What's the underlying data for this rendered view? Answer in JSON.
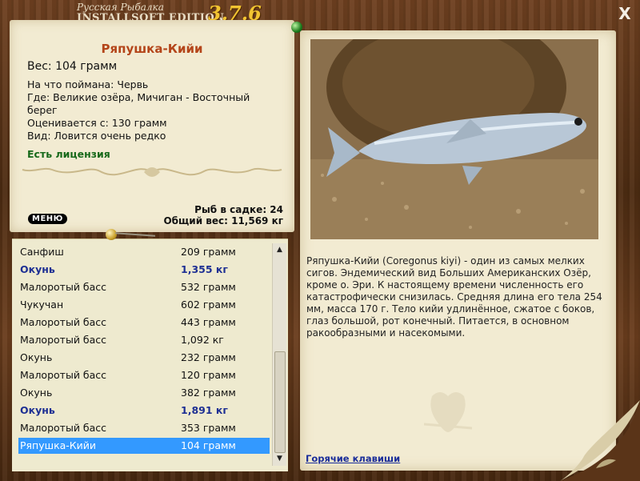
{
  "app": {
    "brand_line1": "Русская Рыбалка",
    "brand_line2": "INSTALLSOFT EDITION",
    "version": "3.7.6",
    "close_label": "X"
  },
  "fish_card": {
    "title": "Ряпушка-Кийи",
    "weight_text": "Вес: 104 грамм",
    "bait_text": "На что поймана: Червь",
    "location_text": "Где: Великие озёра, Мичиган - Восточный берег",
    "valued_from_text": "Оценивается с: 130 грамм",
    "rarity_text": "Вид: Ловится очень редко",
    "license_text": "Есть лицензия"
  },
  "keepnet": {
    "count_text": "Рыб в садке: 24",
    "total_weight_text": "Общий вес: 11,569 кг",
    "menu_label": "МЕНЮ"
  },
  "catch_list": [
    {
      "name": "Санфиш",
      "weight": "209 грамм",
      "bold": false,
      "selected": false
    },
    {
      "name": "Окунь",
      "weight": "1,355 кг",
      "bold": true,
      "selected": false
    },
    {
      "name": "Малоротый басс",
      "weight": "532 грамм",
      "bold": false,
      "selected": false
    },
    {
      "name": "Чукучан",
      "weight": "602 грамм",
      "bold": false,
      "selected": false
    },
    {
      "name": "Малоротый басс",
      "weight": "443 грамм",
      "bold": false,
      "selected": false
    },
    {
      "name": "Малоротый басс",
      "weight": "1,092 кг",
      "bold": false,
      "selected": false
    },
    {
      "name": "Окунь",
      "weight": "232 грамм",
      "bold": false,
      "selected": false
    },
    {
      "name": "Малоротый басс",
      "weight": "120 грамм",
      "bold": false,
      "selected": false
    },
    {
      "name": "Окунь",
      "weight": "382 грамм",
      "bold": false,
      "selected": false
    },
    {
      "name": "Окунь",
      "weight": "1,891 кг",
      "bold": true,
      "selected": false
    },
    {
      "name": "Малоротый басс",
      "weight": "353 грамм",
      "bold": false,
      "selected": false
    },
    {
      "name": "Ряпушка-Кийи",
      "weight": "104 грамм",
      "bold": false,
      "selected": true
    }
  ],
  "description": "Ряпушка-Кийи (Coregonus kiyi) - один из самых мелких сигов. Эндемический вид Больших Американских Озёр, кроме о. Эри. К настоящему времени численность его катастрофически снизилась. Средняя длина его тела 254 мм, масса 170 г. Тело кийи удлинённое, сжатое с боков, глаз большой, рот конечный. Питается, в основном ракообразными и насекомыми.",
  "hotkeys_label": "Горячие клавиши",
  "colors": {
    "title_accent": "#b4451a",
    "license_green": "#17691a",
    "version_gold": "#f2c431",
    "highlight_blue": "#3399ff",
    "bold_row_blue": "#1d2f93"
  }
}
